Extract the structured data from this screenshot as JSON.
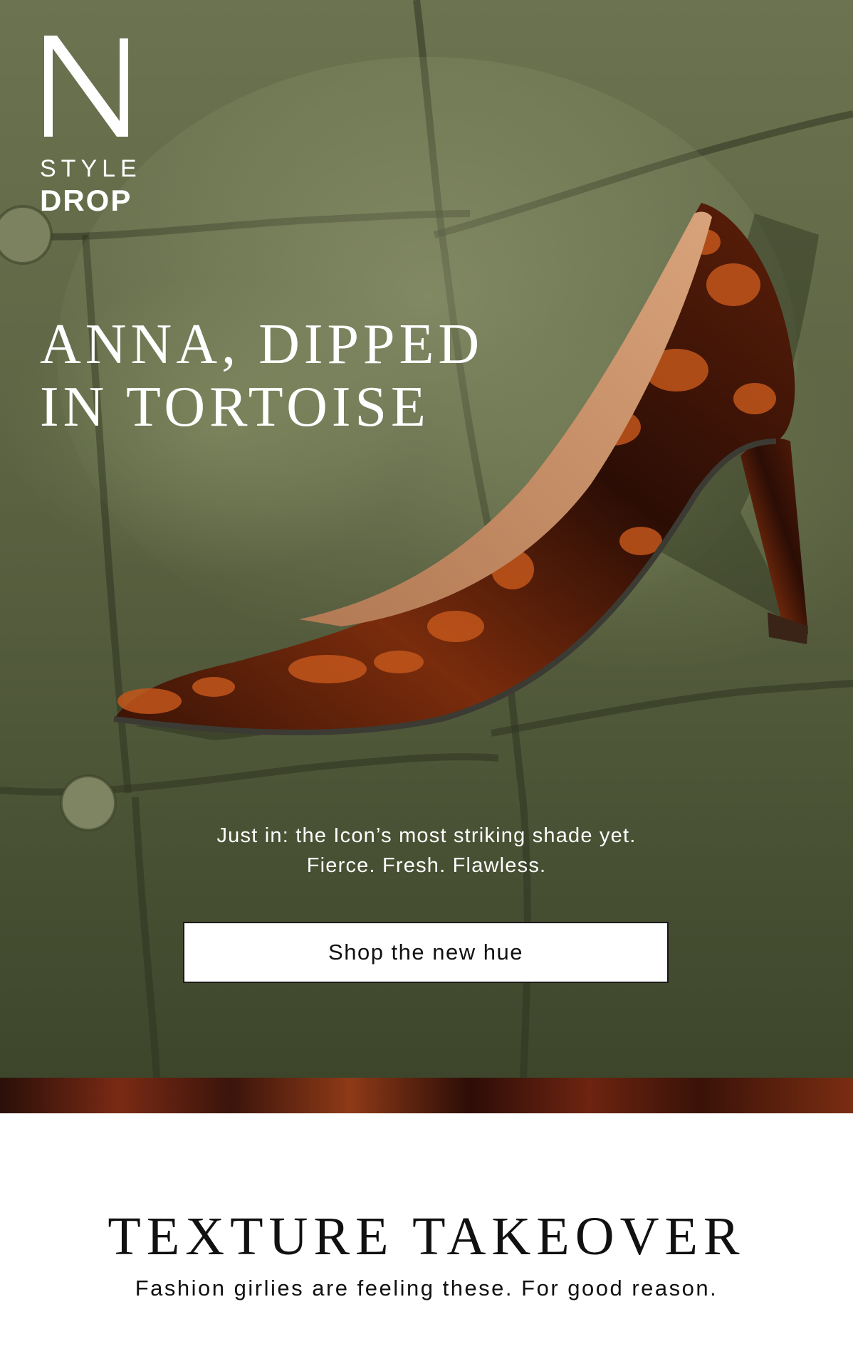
{
  "brand": {
    "logo_letter": "N",
    "logo_line1": "STYLE",
    "logo_line2": "DROP"
  },
  "hero": {
    "headline_line1": "ANNA, DIPPED",
    "headline_line2": "IN TORTOISE",
    "subcopy_line1": "Just in: the Icon’s most striking shade yet.",
    "subcopy_line2": "Fierce. Fresh. Flawless.",
    "cta_label": "Shop the new hue",
    "image_subject": "tortoiseshell-pointed-pump-on-green-velvet-sofa"
  },
  "section": {
    "title": "TEXTURE TAKEOVER",
    "subtitle": "Fashion girlies are feeling these. For good reason."
  },
  "colors": {
    "velvet_green": "#5f6746",
    "tortoise_dark": "#2a0f08",
    "tortoise_amber": "#c0561a",
    "text_dark": "#111111",
    "white": "#ffffff"
  }
}
